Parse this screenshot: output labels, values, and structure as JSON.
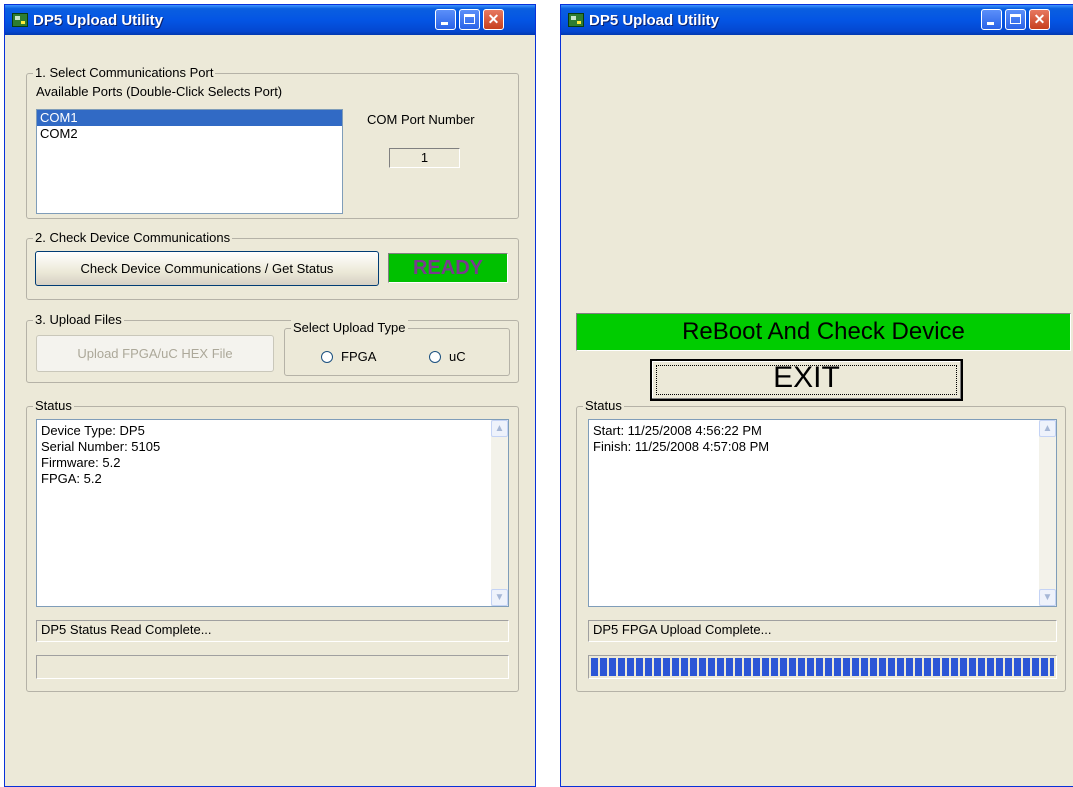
{
  "window1": {
    "title": "DP5 Upload Utility",
    "group1": {
      "legend": "1. Select Communications Port",
      "ports_label": "Available Ports (Double-Click Selects Port)",
      "ports": [
        "COM1",
        "COM2"
      ],
      "selected_port": "COM1",
      "com_port_label": "COM Port Number",
      "com_port_value": "1"
    },
    "group2": {
      "legend": "2. Check Device Communications",
      "check_button": "Check Device Communications / Get Status",
      "ready_indicator": "READY"
    },
    "group3": {
      "legend": "3. Upload Files",
      "upload_button": "Upload FPGA/uC HEX File",
      "upload_type_legend": "Select Upload Type",
      "options": [
        "FPGA",
        "uC"
      ]
    },
    "status": {
      "legend": "Status",
      "lines": "Device Type: DP5\nSerial Number: 5105\nFirmware: 5.2\nFPGA: 5.2",
      "statusbar": "DP5 Status Read Complete...",
      "progress_fraction": 0
    }
  },
  "window2": {
    "title": "DP5 Upload Utility",
    "banner": "ReBoot And Check Device",
    "exit_button": "EXIT",
    "status": {
      "legend": "Status",
      "lines": "Start: 11/25/2008 4:56:22 PM\nFinish: 11/25/2008 4:57:08 PM",
      "statusbar": "DP5 FPGA Upload Complete...",
      "progress_fraction": 1.0
    }
  },
  "icons": {
    "app": "app-icon",
    "minimize": "minimize-icon",
    "maximize": "maximize-icon",
    "close": "close-icon",
    "scroll_up": "scroll-up-arrow-icon",
    "scroll_down": "scroll-down-arrow-icon"
  },
  "colors": {
    "titlebar": "#0455e4",
    "ready_bg": "#00c000",
    "ready_text": "#7a3a8e",
    "banner_bg": "#00cc00",
    "progress": "#2b56d6",
    "selection": "#316ac5"
  }
}
